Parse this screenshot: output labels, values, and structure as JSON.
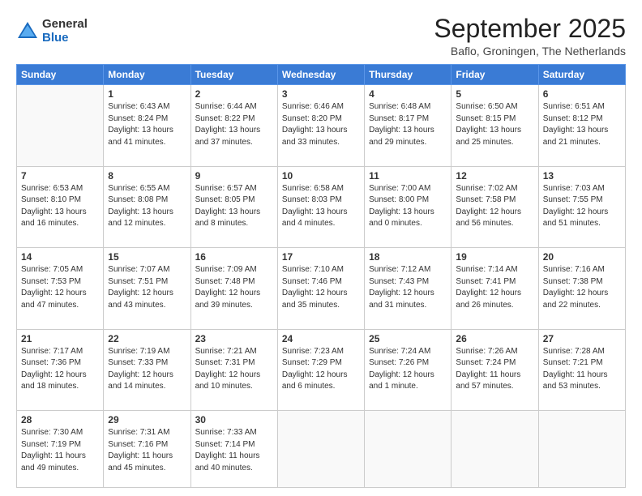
{
  "header": {
    "logo_general": "General",
    "logo_blue": "Blue",
    "month_title": "September 2025",
    "location": "Baflo, Groningen, The Netherlands"
  },
  "weekdays": [
    "Sunday",
    "Monday",
    "Tuesday",
    "Wednesday",
    "Thursday",
    "Friday",
    "Saturday"
  ],
  "weeks": [
    [
      {
        "day": "",
        "sunrise": "",
        "sunset": "",
        "daylight": ""
      },
      {
        "day": "1",
        "sunrise": "Sunrise: 6:43 AM",
        "sunset": "Sunset: 8:24 PM",
        "daylight": "Daylight: 13 hours and 41 minutes."
      },
      {
        "day": "2",
        "sunrise": "Sunrise: 6:44 AM",
        "sunset": "Sunset: 8:22 PM",
        "daylight": "Daylight: 13 hours and 37 minutes."
      },
      {
        "day": "3",
        "sunrise": "Sunrise: 6:46 AM",
        "sunset": "Sunset: 8:20 PM",
        "daylight": "Daylight: 13 hours and 33 minutes."
      },
      {
        "day": "4",
        "sunrise": "Sunrise: 6:48 AM",
        "sunset": "Sunset: 8:17 PM",
        "daylight": "Daylight: 13 hours and 29 minutes."
      },
      {
        "day": "5",
        "sunrise": "Sunrise: 6:50 AM",
        "sunset": "Sunset: 8:15 PM",
        "daylight": "Daylight: 13 hours and 25 minutes."
      },
      {
        "day": "6",
        "sunrise": "Sunrise: 6:51 AM",
        "sunset": "Sunset: 8:12 PM",
        "daylight": "Daylight: 13 hours and 21 minutes."
      }
    ],
    [
      {
        "day": "7",
        "sunrise": "Sunrise: 6:53 AM",
        "sunset": "Sunset: 8:10 PM",
        "daylight": "Daylight: 13 hours and 16 minutes."
      },
      {
        "day": "8",
        "sunrise": "Sunrise: 6:55 AM",
        "sunset": "Sunset: 8:08 PM",
        "daylight": "Daylight: 13 hours and 12 minutes."
      },
      {
        "day": "9",
        "sunrise": "Sunrise: 6:57 AM",
        "sunset": "Sunset: 8:05 PM",
        "daylight": "Daylight: 13 hours and 8 minutes."
      },
      {
        "day": "10",
        "sunrise": "Sunrise: 6:58 AM",
        "sunset": "Sunset: 8:03 PM",
        "daylight": "Daylight: 13 hours and 4 minutes."
      },
      {
        "day": "11",
        "sunrise": "Sunrise: 7:00 AM",
        "sunset": "Sunset: 8:00 PM",
        "daylight": "Daylight: 13 hours and 0 minutes."
      },
      {
        "day": "12",
        "sunrise": "Sunrise: 7:02 AM",
        "sunset": "Sunset: 7:58 PM",
        "daylight": "Daylight: 12 hours and 56 minutes."
      },
      {
        "day": "13",
        "sunrise": "Sunrise: 7:03 AM",
        "sunset": "Sunset: 7:55 PM",
        "daylight": "Daylight: 12 hours and 51 minutes."
      }
    ],
    [
      {
        "day": "14",
        "sunrise": "Sunrise: 7:05 AM",
        "sunset": "Sunset: 7:53 PM",
        "daylight": "Daylight: 12 hours and 47 minutes."
      },
      {
        "day": "15",
        "sunrise": "Sunrise: 7:07 AM",
        "sunset": "Sunset: 7:51 PM",
        "daylight": "Daylight: 12 hours and 43 minutes."
      },
      {
        "day": "16",
        "sunrise": "Sunrise: 7:09 AM",
        "sunset": "Sunset: 7:48 PM",
        "daylight": "Daylight: 12 hours and 39 minutes."
      },
      {
        "day": "17",
        "sunrise": "Sunrise: 7:10 AM",
        "sunset": "Sunset: 7:46 PM",
        "daylight": "Daylight: 12 hours and 35 minutes."
      },
      {
        "day": "18",
        "sunrise": "Sunrise: 7:12 AM",
        "sunset": "Sunset: 7:43 PM",
        "daylight": "Daylight: 12 hours and 31 minutes."
      },
      {
        "day": "19",
        "sunrise": "Sunrise: 7:14 AM",
        "sunset": "Sunset: 7:41 PM",
        "daylight": "Daylight: 12 hours and 26 minutes."
      },
      {
        "day": "20",
        "sunrise": "Sunrise: 7:16 AM",
        "sunset": "Sunset: 7:38 PM",
        "daylight": "Daylight: 12 hours and 22 minutes."
      }
    ],
    [
      {
        "day": "21",
        "sunrise": "Sunrise: 7:17 AM",
        "sunset": "Sunset: 7:36 PM",
        "daylight": "Daylight: 12 hours and 18 minutes."
      },
      {
        "day": "22",
        "sunrise": "Sunrise: 7:19 AM",
        "sunset": "Sunset: 7:33 PM",
        "daylight": "Daylight: 12 hours and 14 minutes."
      },
      {
        "day": "23",
        "sunrise": "Sunrise: 7:21 AM",
        "sunset": "Sunset: 7:31 PM",
        "daylight": "Daylight: 12 hours and 10 minutes."
      },
      {
        "day": "24",
        "sunrise": "Sunrise: 7:23 AM",
        "sunset": "Sunset: 7:29 PM",
        "daylight": "Daylight: 12 hours and 6 minutes."
      },
      {
        "day": "25",
        "sunrise": "Sunrise: 7:24 AM",
        "sunset": "Sunset: 7:26 PM",
        "daylight": "Daylight: 12 hours and 1 minute."
      },
      {
        "day": "26",
        "sunrise": "Sunrise: 7:26 AM",
        "sunset": "Sunset: 7:24 PM",
        "daylight": "Daylight: 11 hours and 57 minutes."
      },
      {
        "day": "27",
        "sunrise": "Sunrise: 7:28 AM",
        "sunset": "Sunset: 7:21 PM",
        "daylight": "Daylight: 11 hours and 53 minutes."
      }
    ],
    [
      {
        "day": "28",
        "sunrise": "Sunrise: 7:30 AM",
        "sunset": "Sunset: 7:19 PM",
        "daylight": "Daylight: 11 hours and 49 minutes."
      },
      {
        "day": "29",
        "sunrise": "Sunrise: 7:31 AM",
        "sunset": "Sunset: 7:16 PM",
        "daylight": "Daylight: 11 hours and 45 minutes."
      },
      {
        "day": "30",
        "sunrise": "Sunrise: 7:33 AM",
        "sunset": "Sunset: 7:14 PM",
        "daylight": "Daylight: 11 hours and 40 minutes."
      },
      {
        "day": "",
        "sunrise": "",
        "sunset": "",
        "daylight": ""
      },
      {
        "day": "",
        "sunrise": "",
        "sunset": "",
        "daylight": ""
      },
      {
        "day": "",
        "sunrise": "",
        "sunset": "",
        "daylight": ""
      },
      {
        "day": "",
        "sunrise": "",
        "sunset": "",
        "daylight": ""
      }
    ]
  ]
}
